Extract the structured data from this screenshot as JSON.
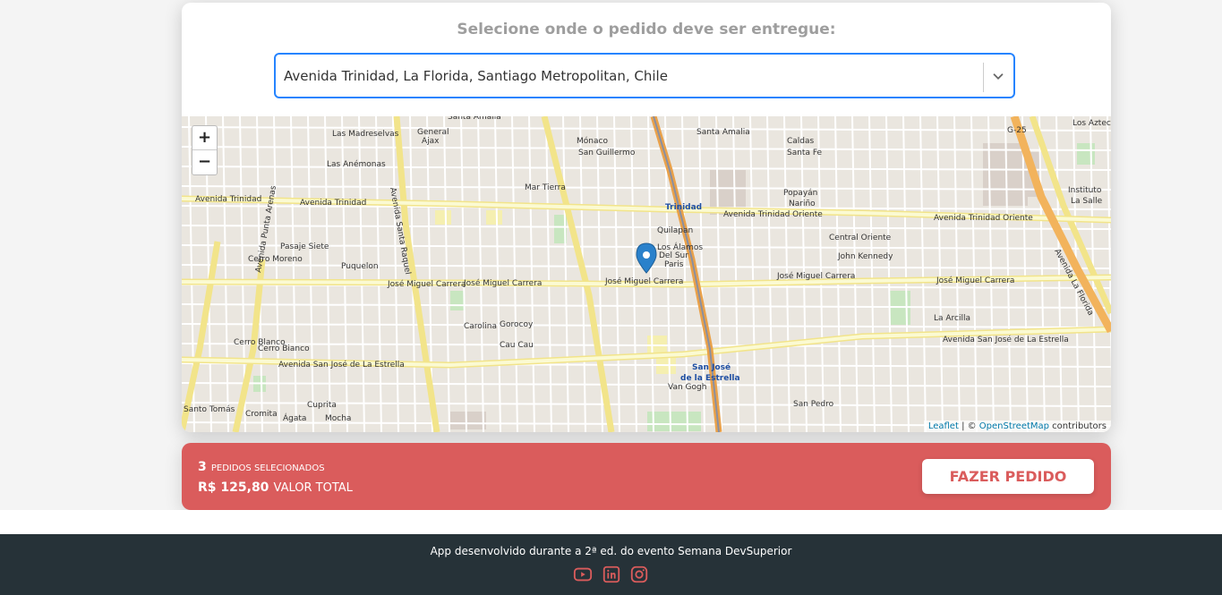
{
  "header": {
    "title": "Selecione onde o pedido deve ser entregue:"
  },
  "address_select": {
    "value": "Avenida Trinidad, La Florida, Santiago Metropolitan, Chile"
  },
  "map": {
    "zoom_in": "+",
    "zoom_out": "−",
    "attribution": {
      "leaflet": "Leaflet",
      "separator": " | © ",
      "osm": "OpenStreetMap",
      "suffix": " contributors"
    },
    "labels": {
      "trinidad_w": "Avenida Trinidad",
      "trinidad_mid": "Avenida Trinidad",
      "trinidad_metro": "Trinidad",
      "trinidad_oriente1": "Avenida Trinidad Oriente",
      "trinidad_oriente2": "Avenida Trinidad Oriente",
      "jmc1": "José Miguel Carrera",
      "jmc2": "José Miguel Carrera",
      "jmc3": "José Miguel Carrera",
      "jmc4": "José Miguel Carrera",
      "jmc5": "José Miguel Carrera",
      "sanjose_w": "Avenida San José de La Estrella",
      "sanjose_e": "Avenida San José de La Estrella",
      "sanjose_metro1": "San José",
      "sanjose_metro2": "de la Estrella",
      "santa_raquel": "Avenida Santa Raquel",
      "la_florida": "Avenida La Florida",
      "punta_arenas": "Avenida Punta Arenas",
      "instituto1": "Instituto",
      "instituto2": "La Salle",
      "g25": "G-25",
      "santa_amalia": "Santa Amalia",
      "los_aztecas": "Los Aztecas",
      "las_madreselvas": "Las Madreselvas",
      "las_anemonas": "Las Anémonas",
      "cerro_moreno": "Cerro Moreno",
      "pasaje_siete": "Pasaje Siete",
      "puquelon": "Puquelon",
      "santo_tomas": "Santo Tomás",
      "central_oriente": "Central Oriente",
      "john_kennedy": "John Kennedy",
      "la_arcilla": "La Arcilla",
      "quilapan": "Quilapan",
      "los_alamos": "Los Álamos",
      "del_sur": "Del Sur",
      "paris": "Paris",
      "monaco": "Mónaco",
      "san_guillermo": "San Guillermo",
      "mar_tierra": "Mar Tierra",
      "general": "General",
      "ajax": "Ajax",
      "nariño": "Nariño",
      "popayan": "Popayán",
      "van_gogh": "Van Gogh",
      "san_pedro": "San Pedro",
      "cerro_blanco": "Cerro Blanco",
      "cerro_bianco": "Cerro Bianco",
      "carolina": "Carolina",
      "cau_cau": "Cau Cau",
      "gorocoy": "Gorocoy",
      "cromita": "Cromita",
      "agata": "Ágata",
      "cuprita": "Cuprita",
      "mocha": "Mocha",
      "caldas": "Caldas",
      "santa_fe": "Santa Fe"
    }
  },
  "summary": {
    "count": "3",
    "count_label": "PEDIDOS SELECIONADOS",
    "total": "R$ 125,80",
    "total_label": "VALOR TOTAL",
    "button": "FAZER PEDIDO"
  },
  "footer": {
    "text": "App desenvolvido durante a 2ª ed. do evento Semana DevSuperior",
    "icons": [
      "youtube-icon",
      "linkedin-icon",
      "instagram-icon"
    ]
  },
  "colors": {
    "accent": "#da5c5c",
    "select_border": "#2684ff",
    "footer_bg": "#263238",
    "road_yellow": "#f7f4a4",
    "metro_line": "#e9a14a"
  }
}
